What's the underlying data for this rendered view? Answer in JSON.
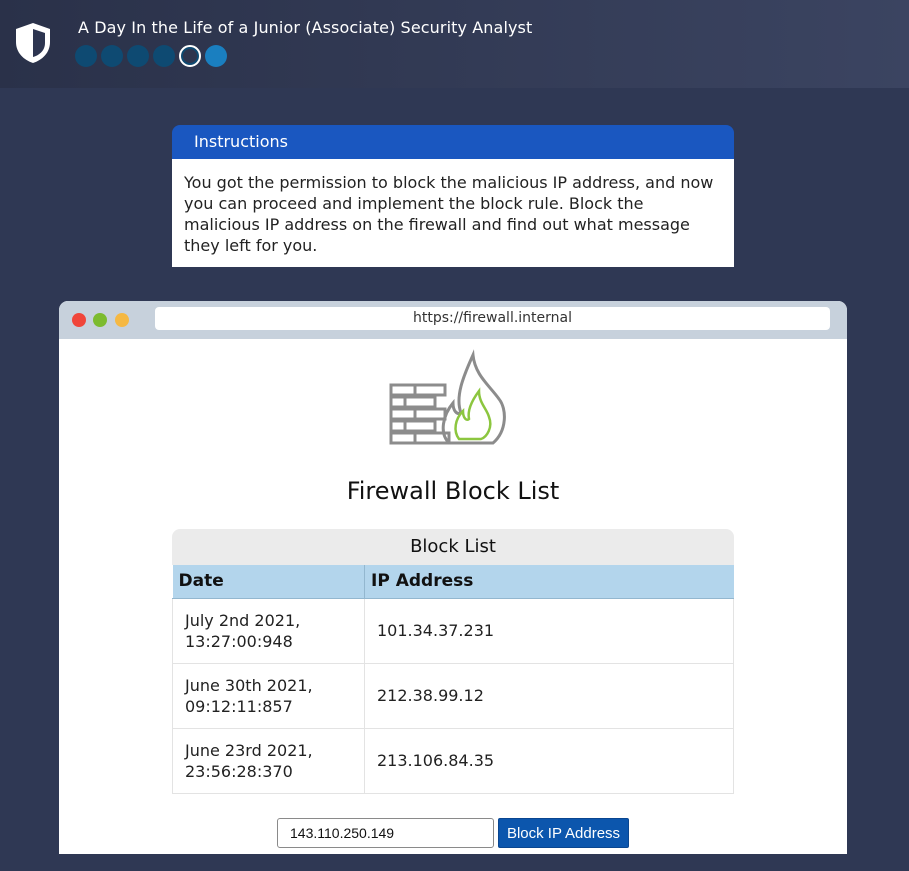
{
  "header": {
    "title": "A Day In the Life of a Junior (Associate) Security Analyst",
    "shield_icon": "shield-icon",
    "progress": {
      "total_steps": 6,
      "current_step": 5
    }
  },
  "instructions": {
    "heading": "Instructions",
    "body": "You got the permission to block the malicious IP address, and now you can proceed and implement the block rule. Block the malicious IP address on the firewall and find out what message they left for you."
  },
  "browser": {
    "url": "https://firewall.internal",
    "logo_icon": "firewall-fire-icon",
    "page_title": "Firewall Block List",
    "table": {
      "caption": "Block List",
      "columns": [
        "Date",
        "IP Address"
      ],
      "rows": [
        {
          "date_line1": "July 2nd 2021,",
          "date_line2": "13:27:00:948",
          "ip": "101.34.37.231"
        },
        {
          "date_line1": "June 30th 2021,",
          "date_line2": "09:12:11:857",
          "ip": "212.38.99.12"
        },
        {
          "date_line1": "June 23rd 2021,",
          "date_line2": "23:56:28:370",
          "ip": "213.106.84.35"
        }
      ]
    },
    "block_input_value": "143.110.250.149",
    "block_button_label": "Block IP Address"
  },
  "colors": {
    "background": "#2f3854",
    "instructions_header": "#1a57c0",
    "table_header": "#b3d5ec",
    "button": "#0c56ad"
  }
}
